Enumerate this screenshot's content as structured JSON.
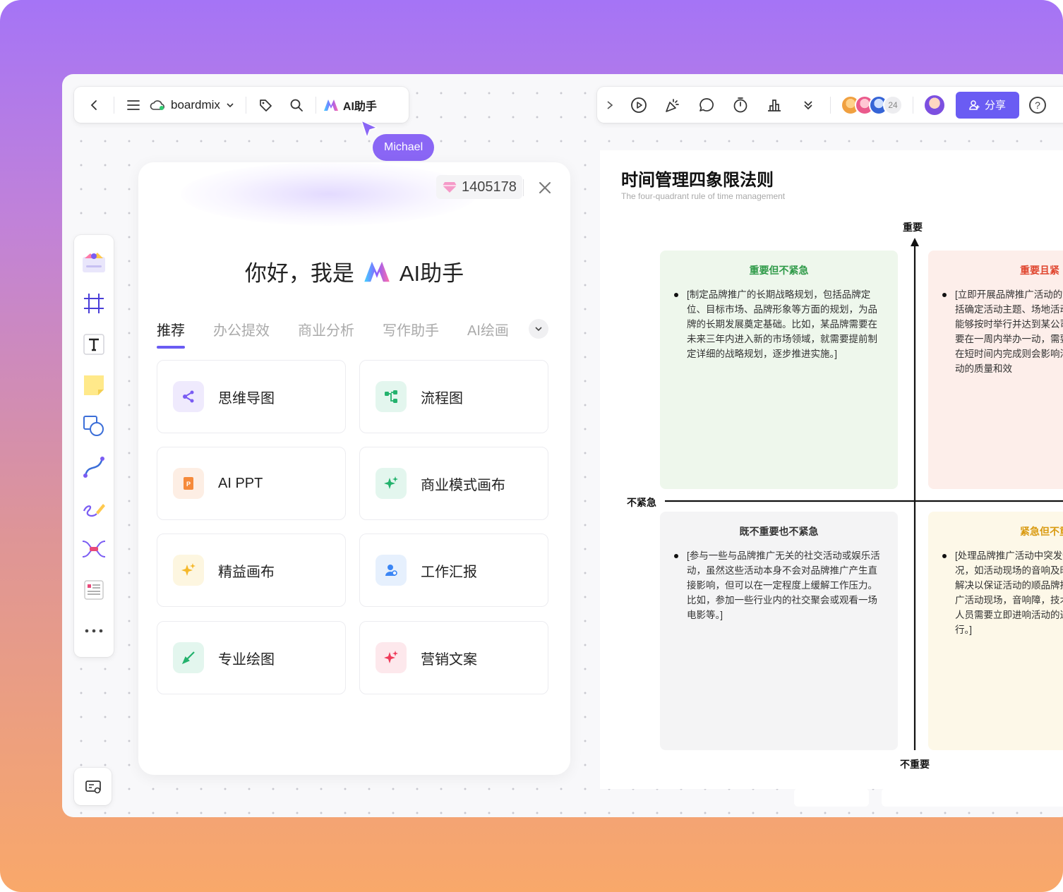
{
  "topbar": {
    "brand": "boardmix",
    "ai_button": "AI助手",
    "cursor_user": "Michael",
    "collab_count": "24",
    "share": "分享",
    "help": "?"
  },
  "ai_panel": {
    "credits": "1405178",
    "greeting_prefix": "你好，我是",
    "greeting_name": "AI助手",
    "tabs": [
      "推荐",
      "办公提效",
      "商业分析",
      "写作助手",
      "AI绘画"
    ],
    "tiles": [
      {
        "label": "思维导图",
        "icon": "mindmap-icon"
      },
      {
        "label": "流程图",
        "icon": "flowchart-icon"
      },
      {
        "label": "AI PPT",
        "icon": "ppt-icon"
      },
      {
        "label": "商业模式画布",
        "icon": "sparkle-icon"
      },
      {
        "label": "精益画布",
        "icon": "sparkle-icon"
      },
      {
        "label": "工作汇报",
        "icon": "report-icon"
      },
      {
        "label": "专业绘图",
        "icon": "drawing-icon"
      },
      {
        "label": "营销文案",
        "icon": "sparkle-icon"
      }
    ]
  },
  "board": {
    "title": "时间管理四象限法则",
    "subtitle": "The four-quadrant rule of time management",
    "axis_top": "重要",
    "axis_bottom": "不重要",
    "axis_left": "不紧急",
    "quadrants": {
      "tl": {
        "title": "重要但不紧急",
        "body": "[制定品牌推广的长期战略规划，包括品牌定位、目标市场、品牌形象等方面的规划，为品牌的长期发展奠定基础。比如，某品牌需要在未来三年内进入新的市场领域，就需要提前制定详细的战略规划，逐步推进实施。]"
      },
      "tr": {
        "title": "重要且紧",
        "body": "[立即开展品牌推广活动的包括确定活动主题、场地活动能够按时举行并达到某公司要在一周内举办一动，需要在短时间内完成则会影响活动的质量和效"
      },
      "bl": {
        "title": "既不重要也不紧急",
        "body": "[参与一些与品牌推广无关的社交活动或娱乐活动，虽然这些活动本身不会对品牌推广产生直接影响，但可以在一定程度上缓解工作压力。比如，参加一些行业内的社交聚会或观看一场电影等。]"
      },
      "br": {
        "title": "紧急但不重",
        "body": "[处理品牌推广活动中突发情况，如活动现场的音响及时解决以保证活动的顺品牌推广活动现场，音响障，技术人员需要立即进响活动的进行。]"
      }
    }
  },
  "colors": {
    "accent": "#6a5cf3",
    "tl_bg": "#eef7ec",
    "tl_title": "#2e9a48",
    "tr_bg": "#fdeeea",
    "tr_title": "#e0452e",
    "bl_bg": "#f4f4f5",
    "br_bg": "#fdf8e8",
    "br_title": "#d99a10"
  }
}
